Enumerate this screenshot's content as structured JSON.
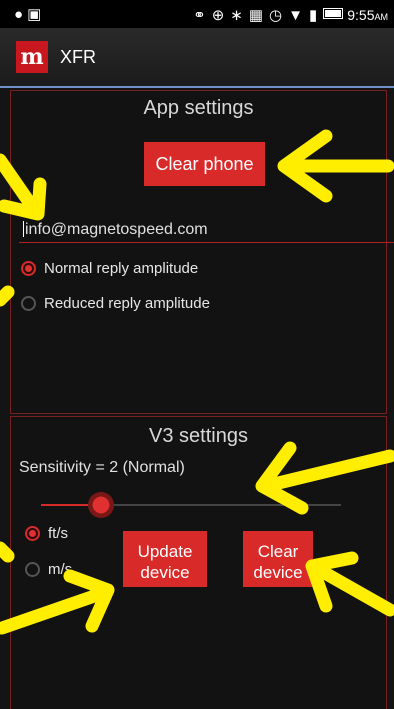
{
  "status_bar": {
    "left_icons": [
      "circle-icon",
      "bag-icon"
    ],
    "right_icons": [
      "headset-icon",
      "gps-icon",
      "bluetooth-icon",
      "nfc-icon",
      "alarm-icon",
      "wifi-icon",
      "signal-icon",
      "battery-icon"
    ],
    "time": "9:55",
    "ampm": "AM"
  },
  "action_bar": {
    "title": "XFR",
    "logo_text": "m"
  },
  "app_settings": {
    "title": "App settings",
    "clear_phone_label": "Clear phone",
    "email_value": "info@magnetospeed.com",
    "reply_options": [
      {
        "label": "Normal reply amplitude",
        "selected": true
      },
      {
        "label": "Reduced reply amplitude",
        "selected": false
      }
    ]
  },
  "v3_settings": {
    "title": "V3 settings",
    "sensitivity_label": "Sensitivity = 2 (Normal)",
    "sensitivity_value": 2,
    "unit_options": [
      {
        "label": "ft/s",
        "selected": true
      },
      {
        "label": "m/s",
        "selected": false
      }
    ],
    "update_device_line1": "Update",
    "update_device_line2": "device",
    "clear_device_line1": "Clear",
    "clear_device_line2": "device"
  },
  "colors": {
    "accent_red": "#d92a2a",
    "annotation_yellow": "#ffee00",
    "actionbar_divider": "#6f93c9"
  }
}
